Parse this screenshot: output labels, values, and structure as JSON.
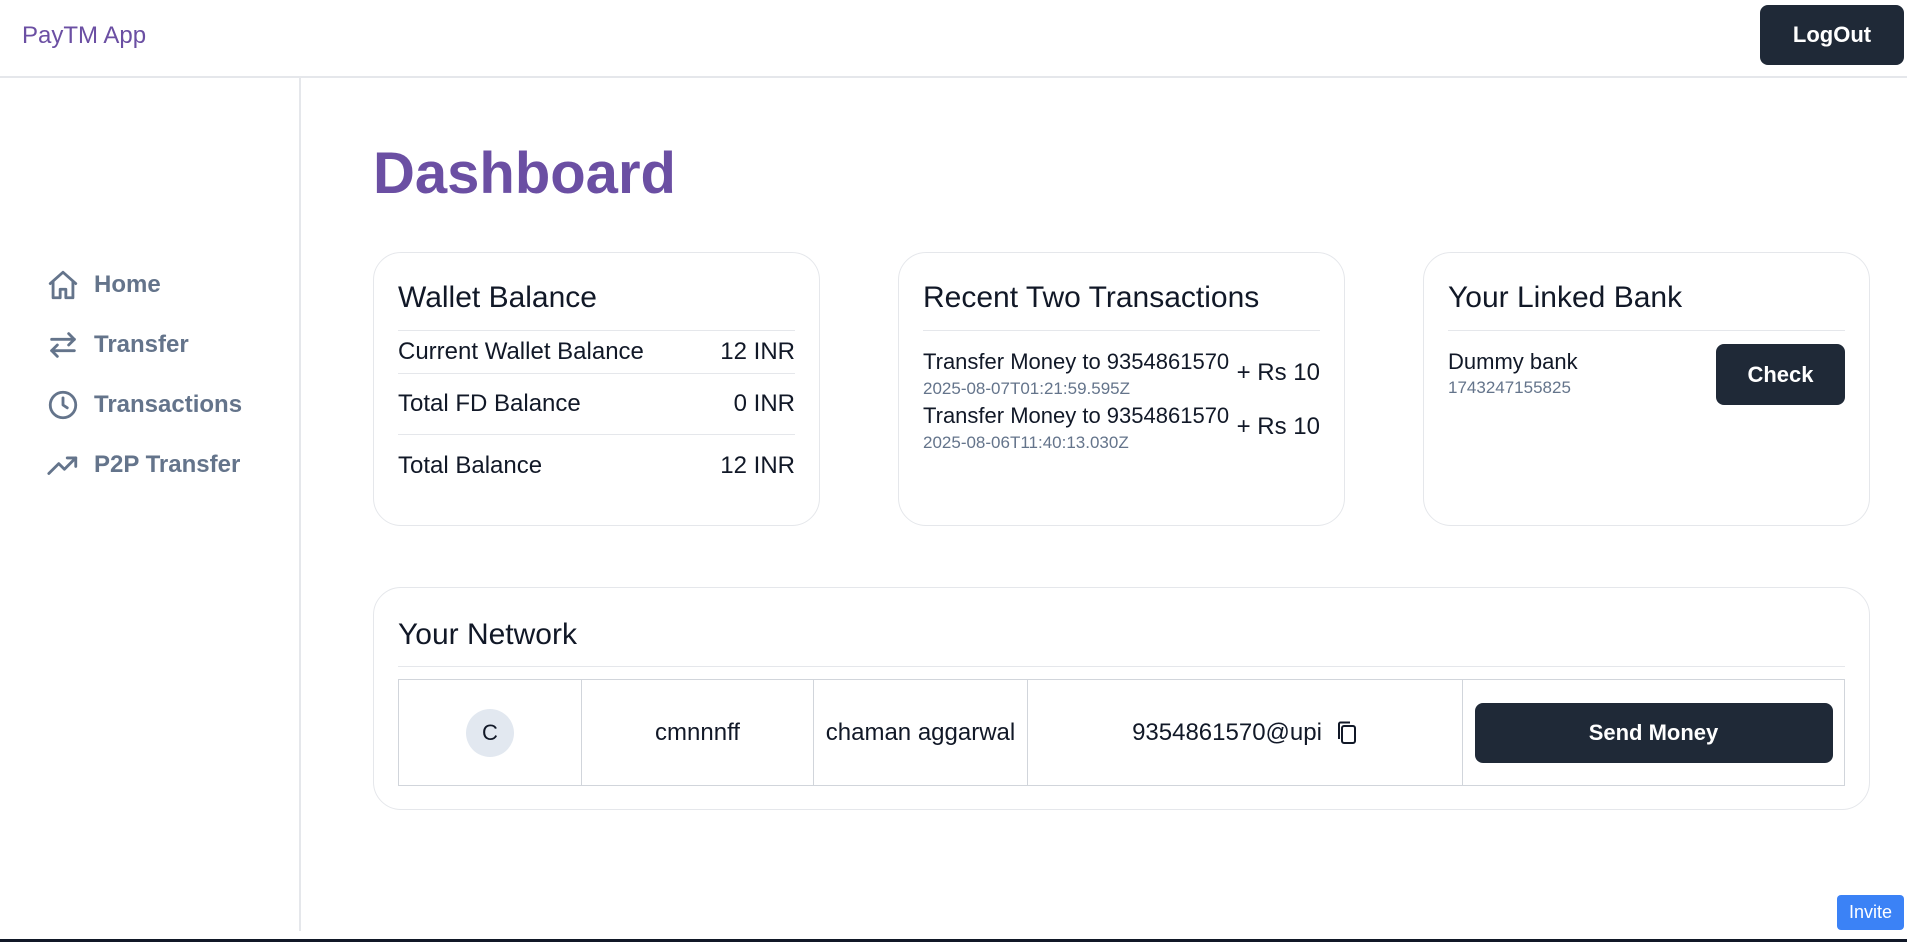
{
  "header": {
    "brand": "PayTM App",
    "logout_label": "LogOut"
  },
  "sidebar": {
    "items": [
      {
        "label": "Home",
        "icon": "home-icon"
      },
      {
        "label": "Transfer",
        "icon": "transfer-arrows-icon"
      },
      {
        "label": "Transactions",
        "icon": "clock-icon"
      },
      {
        "label": "P2P Transfer",
        "icon": "trending-up-icon"
      }
    ]
  },
  "main": {
    "title": "Dashboard"
  },
  "wallet": {
    "title": "Wallet Balance",
    "rows": [
      {
        "label": "Current Wallet Balance",
        "value": "12 INR"
      },
      {
        "label": "Total FD Balance",
        "value": "0 INR"
      },
      {
        "label": "Total Balance",
        "value": "12 INR"
      }
    ]
  },
  "transactions": {
    "title": "Recent Two Transactions",
    "items": [
      {
        "description": "Transfer Money to 9354861570",
        "date": "2025-08-07T01:21:59.595Z",
        "amount": "+ Rs 10"
      },
      {
        "description": "Transfer Money to 9354861570",
        "date": "2025-08-06T11:40:13.030Z",
        "amount": "+ Rs 10"
      }
    ]
  },
  "bank": {
    "title": "Your Linked Bank",
    "name": "Dummy bank",
    "account": "1743247155825",
    "check_label": "Check"
  },
  "network": {
    "title": "Your Network",
    "rows": [
      {
        "avatar": "C",
        "username": "cmnnnff",
        "name": "chaman aggarwal",
        "upi": "9354861570@upi",
        "action_label": "Send Money"
      }
    ]
  },
  "invite_label": "Invite",
  "colors": {
    "brand": "#6b4fa3",
    "dark_button": "#1f2937",
    "nav_text": "#64748b",
    "invite": "#3b82f6"
  }
}
